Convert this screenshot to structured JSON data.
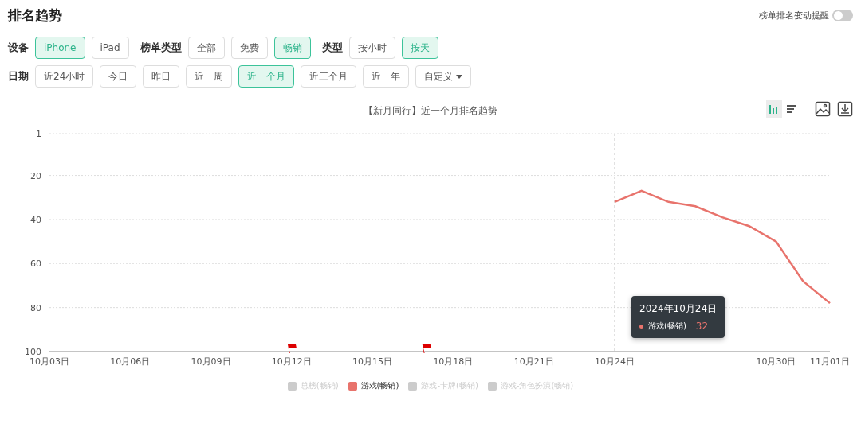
{
  "title": "排名趋势",
  "alert_toggle": {
    "label": "榜单排名变动提醒",
    "on": false
  },
  "filters": [
    {
      "label": "设备",
      "options": [
        {
          "label": "iPhone",
          "selected": true
        },
        {
          "label": "iPad",
          "selected": false
        }
      ]
    },
    {
      "label": "榜单类型",
      "options": [
        {
          "label": "全部",
          "selected": false
        },
        {
          "label": "免费",
          "selected": false
        },
        {
          "label": "畅销",
          "selected": true
        }
      ]
    },
    {
      "label": "类型",
      "options": [
        {
          "label": "按小时",
          "selected": false
        },
        {
          "label": "按天",
          "selected": true
        }
      ]
    }
  ],
  "date_filter": {
    "label": "日期",
    "options": [
      {
        "label": "近24小时",
        "selected": false
      },
      {
        "label": "今日",
        "selected": false
      },
      {
        "label": "昨日",
        "selected": false
      },
      {
        "label": "近一周",
        "selected": false
      },
      {
        "label": "近一个月",
        "selected": true
      },
      {
        "label": "近三个月",
        "selected": false
      },
      {
        "label": "近一年",
        "selected": false
      },
      {
        "label": "自定义",
        "selected": false,
        "kind": "dropdown"
      }
    ]
  },
  "chart": {
    "view_toggle": [
      {
        "kind": "bar",
        "selected": true
      },
      {
        "kind": "list",
        "selected": false
      }
    ],
    "actions": [
      {
        "kind": "image"
      },
      {
        "kind": "download"
      }
    ],
    "chart_data": {
      "type": "line",
      "title": "【新月同行】近一个月排名趋势",
      "categories": [
        "10月03日",
        null,
        null,
        "10月06日",
        null,
        null,
        "10月09日",
        null,
        null,
        "10月12日",
        null,
        null,
        "10月15日",
        null,
        null,
        "10月18日",
        null,
        null,
        "10月21日",
        null,
        null,
        "10月24日",
        null,
        null,
        null,
        null,
        null,
        "10月30日",
        null,
        "11月01日"
      ],
      "series": [
        {
          "name": "游戏(畅销)",
          "color": "#e8736c",
          "values": [
            null,
            null,
            null,
            null,
            null,
            null,
            null,
            null,
            null,
            null,
            null,
            null,
            null,
            null,
            null,
            null,
            null,
            null,
            null,
            null,
            null,
            32,
            27,
            32,
            34,
            39,
            43,
            50,
            68,
            78
          ]
        }
      ],
      "ylim": [
        100,
        1
      ],
      "yticks": [
        1,
        20,
        40,
        60,
        80,
        100
      ],
      "grid": true
    },
    "tooltip": {
      "title": "2024年10月24日",
      "value": "32",
      "color": "#e8736c"
    },
    "legend": [
      {
        "label": "总榜(畅销)",
        "on": false,
        "color": "#cccccc"
      },
      {
        "label": "游戏(畅销)",
        "on": true,
        "color": "#e8736c"
      },
      {
        "label": "游戏-卡牌(畅销)",
        "on": false,
        "color": "#cccccc"
      },
      {
        "label": "游戏-角色扮演(畅销)",
        "on": false,
        "color": "#cccccc"
      }
    ]
  }
}
